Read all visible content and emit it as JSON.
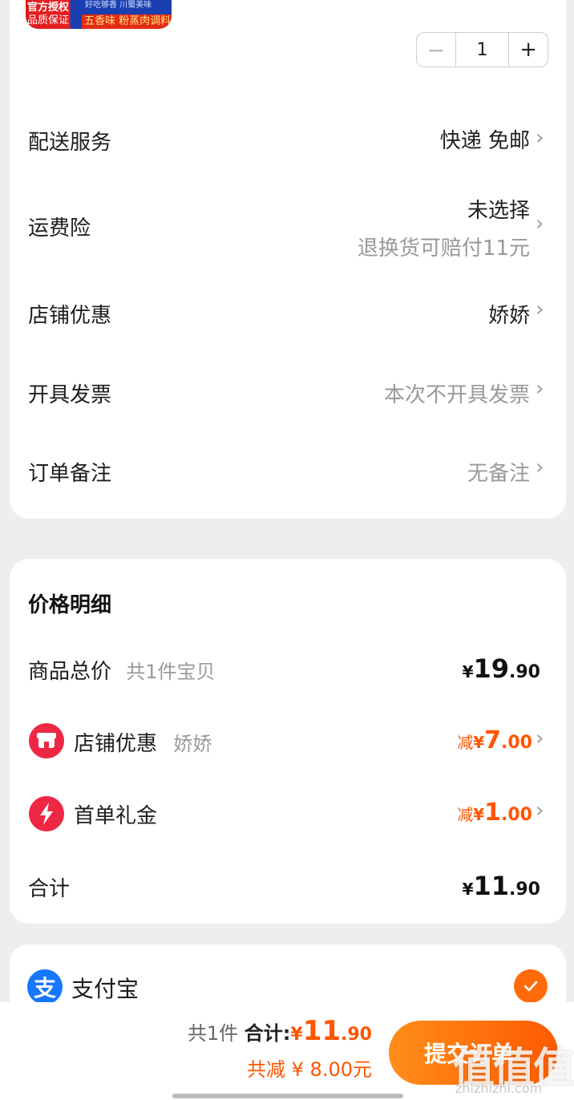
{
  "product": {
    "thumb_line1": "官方授权",
    "thumb_line2": "品质保证",
    "thumb_tag": "五香味 粉蒸肉调料",
    "thumb_top_right": "好吃够香 川蜀美味",
    "quantity": "1",
    "minus_symbol": "−",
    "plus_symbol": "+"
  },
  "order_rows": [
    {
      "label": "配送服务",
      "value": "快递  免邮"
    },
    {
      "label": "运费险",
      "value": "未选择",
      "subvalue": "退换货可赔付11元"
    },
    {
      "label": "店铺优惠",
      "value": "娇娇"
    },
    {
      "label": "开具发票",
      "value": "本次不开具发票"
    },
    {
      "label": "订单备注",
      "value": "无备注"
    }
  ],
  "price_detail": {
    "title": "价格明细",
    "goods_total_label": "商品总价",
    "goods_total_sub": "共1件宝贝",
    "goods_total": {
      "symbol": "¥",
      "int": "19",
      "dec": ".90"
    },
    "shop_discount_label": "店铺优惠",
    "shop_discount_sub": "娇娇",
    "shop_discount": {
      "prefix": "减",
      "symbol": "¥",
      "int": "7",
      "dec": ".00"
    },
    "first_order_label": "首单礼金",
    "first_order": {
      "prefix": "减",
      "symbol": "¥",
      "int": "1",
      "dec": ".00"
    },
    "sum_label": "合计",
    "sum": {
      "symbol": "¥",
      "int": "11",
      "dec": ".90"
    }
  },
  "payment": {
    "icon_glyph": "支",
    "label": "支付宝"
  },
  "bottom": {
    "count": "共1件",
    "total_label": "合计:",
    "total": {
      "symbol": "¥",
      "int": "11",
      "dec": ".90"
    },
    "saved": "共减 ¥ 8.00元",
    "submit": "提交订单",
    "watermark": "值值值",
    "watermark_url": "zhizhizhi.com"
  },
  "colors": {
    "accent": "#ff5500",
    "alipay": "#1677ff",
    "shop_icon": "#ee2744"
  }
}
